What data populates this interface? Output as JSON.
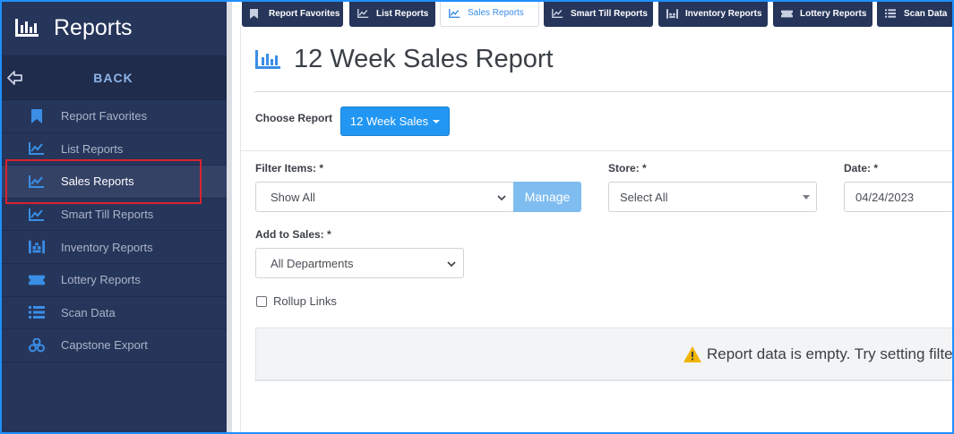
{
  "sidebar": {
    "title": "Reports",
    "back_label": "BACK",
    "items": [
      {
        "label": "Report Favorites",
        "icon": "bookmark-icon"
      },
      {
        "label": "List Reports",
        "icon": "line-chart-icon"
      },
      {
        "label": "Sales Reports",
        "icon": "line-chart-icon",
        "active": true
      },
      {
        "label": "Smart Till Reports",
        "icon": "line-chart-icon"
      },
      {
        "label": "Inventory Reports",
        "icon": "warehouse-icon"
      },
      {
        "label": "Lottery Reports",
        "icon": "ticket-icon"
      },
      {
        "label": "Scan Data",
        "icon": "list-icon"
      },
      {
        "label": "Capstone Export",
        "icon": "cubes-icon"
      }
    ]
  },
  "tabs": [
    {
      "label": "Report Favorites",
      "icon": "bookmark-icon"
    },
    {
      "label": "List Reports",
      "icon": "line-chart-icon"
    },
    {
      "label": "Sales Reports",
      "icon": "line-chart-icon",
      "active": true
    },
    {
      "label": "Smart Till Reports",
      "icon": "line-chart-icon"
    },
    {
      "label": "Inventory Reports",
      "icon": "warehouse-icon"
    },
    {
      "label": "Lottery Reports",
      "icon": "ticket-icon"
    },
    {
      "label": "Scan Data",
      "icon": "list-icon"
    }
  ],
  "page": {
    "title": "12 Week Sales Report",
    "choose_report_label": "Choose Report",
    "choose_report_value": "12 Week Sales",
    "filter_items_label": "Filter Items: *",
    "filter_items_value": "Show All",
    "manage_label": "Manage",
    "store_label": "Store: *",
    "store_value": "Select All",
    "date_label": "Date: *",
    "date_value": "04/24/2023",
    "add_to_sales_label": "Add to Sales: *",
    "add_to_sales_value": "All Departments",
    "rollup_label": "Rollup Links",
    "rollup_checked": false,
    "empty_message": "Report data is empty. Try setting filte"
  },
  "colors": {
    "sidebar_bg": "#26355a",
    "accent": "#2196f3",
    "highlight": "#d9232e",
    "warning": "#f0b400"
  }
}
